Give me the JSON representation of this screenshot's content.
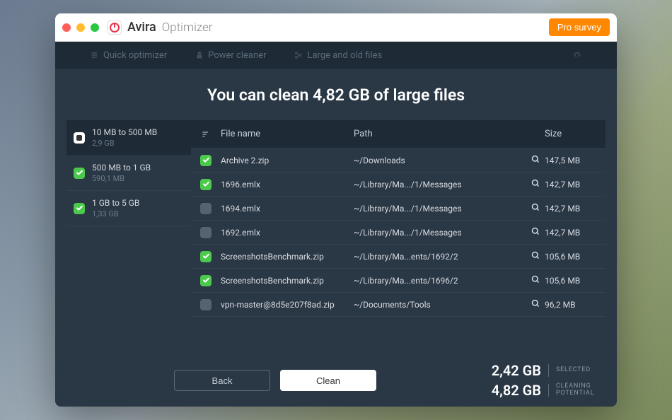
{
  "titlebar": {
    "brand": "Avira",
    "sub": "Optimizer",
    "pro_button": "Pro survey"
  },
  "tabs": {
    "quick": "Quick optimizer",
    "power": "Power cleaner",
    "large": "Large and old files"
  },
  "headline": "You can clean 4,82 GB of large files",
  "columns": {
    "name": "File name",
    "path": "Path",
    "size": "Size"
  },
  "ranges": [
    {
      "label": "10 MB to 500 MB",
      "size": "2,9 GB",
      "state": "partial",
      "active": true
    },
    {
      "label": "500 MB to 1 GB",
      "size": "590,1 MB",
      "state": "checked",
      "active": false
    },
    {
      "label": "1 GB to 5 GB",
      "size": "1,33 GB",
      "state": "checked",
      "active": false
    }
  ],
  "files": [
    {
      "checked": true,
      "name": "Archive 2.zip",
      "path": "~/Downloads",
      "size": "147,5 MB"
    },
    {
      "checked": true,
      "name": "1696.emlx",
      "path": "~/Library/Ma.../1/Messages",
      "size": "142,7 MB"
    },
    {
      "checked": false,
      "name": "1694.emlx",
      "path": "~/Library/Ma.../1/Messages",
      "size": "142,7 MB"
    },
    {
      "checked": false,
      "name": "1692.emlx",
      "path": "~/Library/Ma.../1/Messages",
      "size": "142,7 MB"
    },
    {
      "checked": true,
      "name": "ScreenshotsBenchmark.zip",
      "path": "~/Library/Ma...ents/1692/2",
      "size": "105,6 MB"
    },
    {
      "checked": true,
      "name": "ScreenshotsBenchmark.zip",
      "path": "~/Library/Ma...ents/1696/2",
      "size": "105,6 MB"
    },
    {
      "checked": false,
      "name": "vpn-master@8d5e207f8ad.zip",
      "path": "~/Documents/Tools",
      "size": "96,2 MB"
    }
  ],
  "footer": {
    "back": "Back",
    "clean": "Clean",
    "selected_size": "2,42 GB",
    "selected_label": "SELECTED",
    "potential_size": "4,82 GB",
    "potential_label": "CLEANING POTENTIAL"
  }
}
